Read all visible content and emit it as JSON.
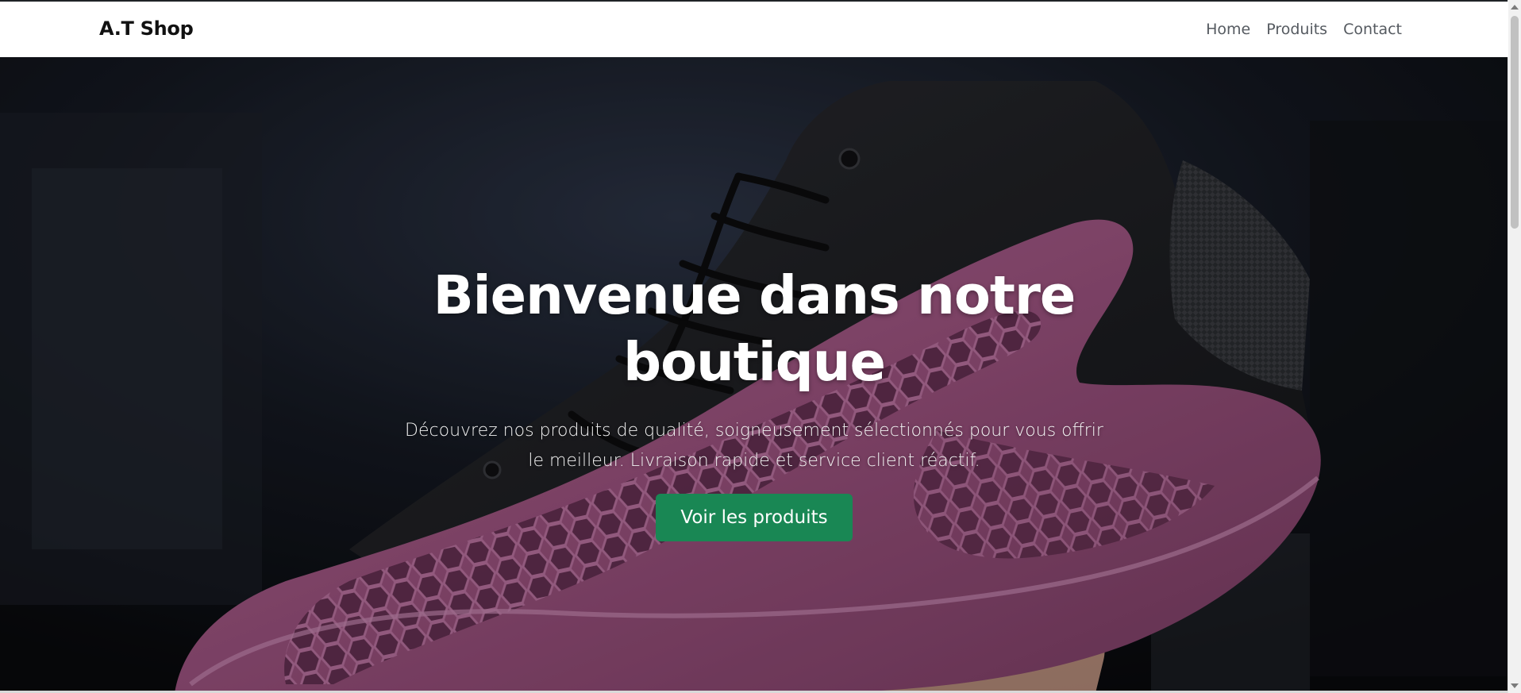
{
  "navbar": {
    "brand": "A.T Shop",
    "links": [
      {
        "label": "Home"
      },
      {
        "label": "Produits"
      },
      {
        "label": "Contact"
      }
    ]
  },
  "hero": {
    "title": "Bienvenue dans notre boutique",
    "text": "Découvrez nos produits de qualité, soigneusement sélectionnés pour vous offrir le meilleur. Livraison rapide et service client réactif.",
    "button_label": "Voir les produits",
    "image": "sneaker-photo"
  },
  "colors": {
    "primary_button": "#198754",
    "navbar_bg": "#ffffff",
    "sneaker_body": "#9e5a86",
    "sneaker_upper": "#1c1d21"
  }
}
